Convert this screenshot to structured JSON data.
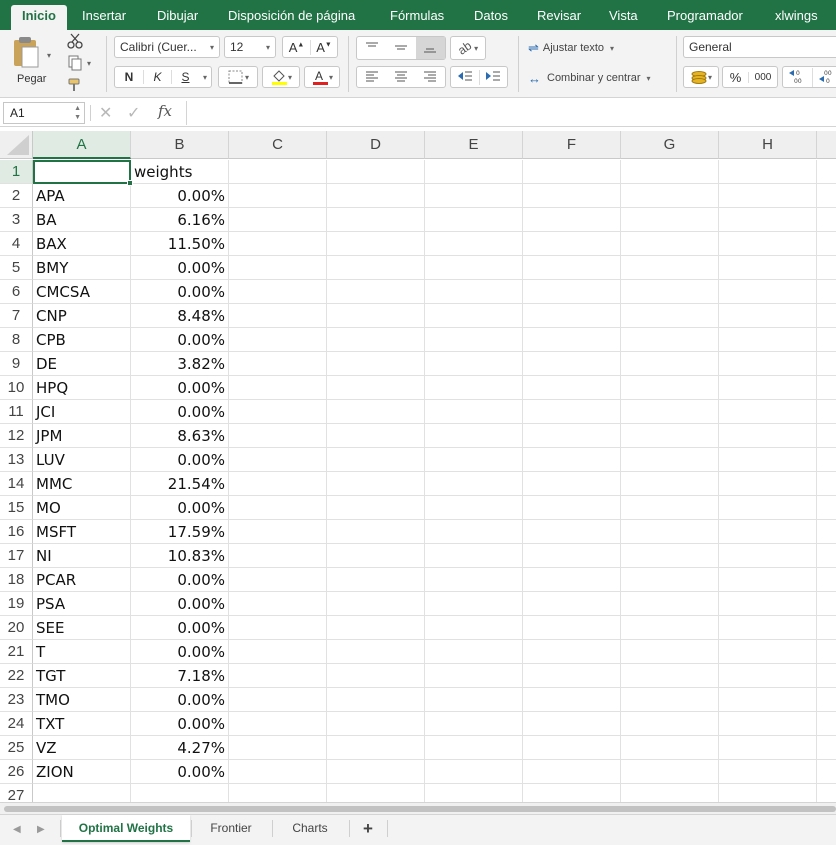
{
  "ribbon_tabs": [
    "Inicio",
    "Insertar",
    "Dibujar",
    "Disposición de página",
    "Fórmulas",
    "Datos",
    "Revisar",
    "Vista",
    "Programador",
    "xlwings"
  ],
  "ribbon": {
    "paste_label": "Pegar",
    "font_name": "Calibri (Cuer...",
    "font_size": "12",
    "bold_label": "N",
    "italic_label": "K",
    "underline_label": "S",
    "wrap_text_label": "Ajustar texto",
    "merge_center_label": "Combinar y centrar",
    "number_format": "General",
    "percent_label": "%",
    "thousands_label": "000"
  },
  "formula_bar": {
    "name_box": "A1",
    "fx_label": "fx",
    "formula": ""
  },
  "columns": [
    "A",
    "B",
    "C",
    "D",
    "E",
    "F",
    "G",
    "H"
  ],
  "rows": [
    {
      "n": "1",
      "a": "",
      "b": "weights"
    },
    {
      "n": "2",
      "a": "APA",
      "b": "0.00%"
    },
    {
      "n": "3",
      "a": "BA",
      "b": "6.16%"
    },
    {
      "n": "4",
      "a": "BAX",
      "b": "11.50%"
    },
    {
      "n": "5",
      "a": "BMY",
      "b": "0.00%"
    },
    {
      "n": "6",
      "a": "CMCSA",
      "b": "0.00%"
    },
    {
      "n": "7",
      "a": "CNP",
      "b": "8.48%"
    },
    {
      "n": "8",
      "a": "CPB",
      "b": "0.00%"
    },
    {
      "n": "9",
      "a": "DE",
      "b": "3.82%"
    },
    {
      "n": "10",
      "a": "HPQ",
      "b": "0.00%"
    },
    {
      "n": "11",
      "a": "JCI",
      "b": "0.00%"
    },
    {
      "n": "12",
      "a": "JPM",
      "b": "8.63%"
    },
    {
      "n": "13",
      "a": "LUV",
      "b": "0.00%"
    },
    {
      "n": "14",
      "a": "MMC",
      "b": "21.54%"
    },
    {
      "n": "15",
      "a": "MO",
      "b": "0.00%"
    },
    {
      "n": "16",
      "a": "MSFT",
      "b": "17.59%"
    },
    {
      "n": "17",
      "a": "NI",
      "b": "10.83%"
    },
    {
      "n": "18",
      "a": "PCAR",
      "b": "0.00%"
    },
    {
      "n": "19",
      "a": "PSA",
      "b": "0.00%"
    },
    {
      "n": "20",
      "a": "SEE",
      "b": "0.00%"
    },
    {
      "n": "21",
      "a": "T",
      "b": "0.00%"
    },
    {
      "n": "22",
      "a": "TGT",
      "b": "7.18%"
    },
    {
      "n": "23",
      "a": "TMO",
      "b": "0.00%"
    },
    {
      "n": "24",
      "a": "TXT",
      "b": "0.00%"
    },
    {
      "n": "25",
      "a": "VZ",
      "b": "4.27%"
    },
    {
      "n": "26",
      "a": "ZION",
      "b": "0.00%"
    },
    {
      "n": "27",
      "a": "",
      "b": ""
    }
  ],
  "sheet_tabs": [
    "Optimal Weights",
    "Frontier",
    "Charts"
  ],
  "add_sheet_label": "+",
  "colors": {
    "excel_green": "#217346",
    "font_color_red": "#e02020",
    "highlight_yellow": "#ffff00"
  }
}
